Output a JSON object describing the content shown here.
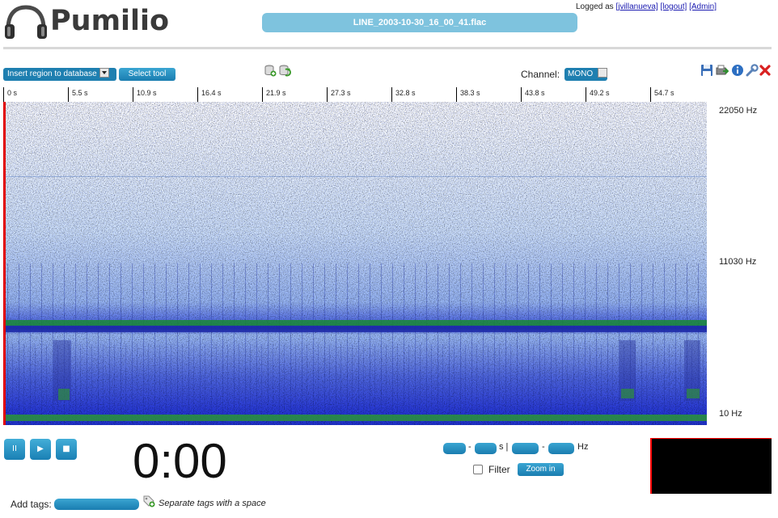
{
  "app": {
    "name": "Pumilio"
  },
  "file": {
    "name": "LINE_2003-10-30_16_00_41.flac"
  },
  "login": {
    "prefix": "Logged as",
    "user": "[jvillanueva]",
    "logout": "[logout]",
    "admin": "[Admin]"
  },
  "toolbar": {
    "region_select": "Insert region to database",
    "select_tool": "Select tool",
    "channel_label": "Channel:",
    "channel_value": "MONO",
    "icons": [
      "db-add-icon",
      "db-refresh-icon",
      "save-icon",
      "export-icon",
      "info-icon",
      "wrench-icon",
      "close-icon"
    ]
  },
  "timeline": {
    "ticks": [
      "0 s",
      "5.5 s",
      "10.9 s",
      "16.4 s",
      "21.9 s",
      "27.3 s",
      "32.8 s",
      "38.3 s",
      "43.8 s",
      "49.2 s",
      "54.7 s"
    ]
  },
  "freq": {
    "top": "22050 Hz",
    "mid": "11030 Hz",
    "bottom": "10 Hz"
  },
  "player": {
    "pause": "II",
    "play": "▶",
    "stop": "■",
    "time": "0:00"
  },
  "range": {
    "dash1": "-",
    "s_sep": "s |",
    "dash2": "-",
    "hz": "Hz"
  },
  "filter": {
    "label": "Filter",
    "zoom": "Zoom in"
  },
  "tags": {
    "label": "Add tags:",
    "hint": "Separate tags with a space"
  },
  "colors": {
    "accent": "#1e7fb0",
    "title_bar": "#7ec3de",
    "playhead": "#e10000"
  }
}
